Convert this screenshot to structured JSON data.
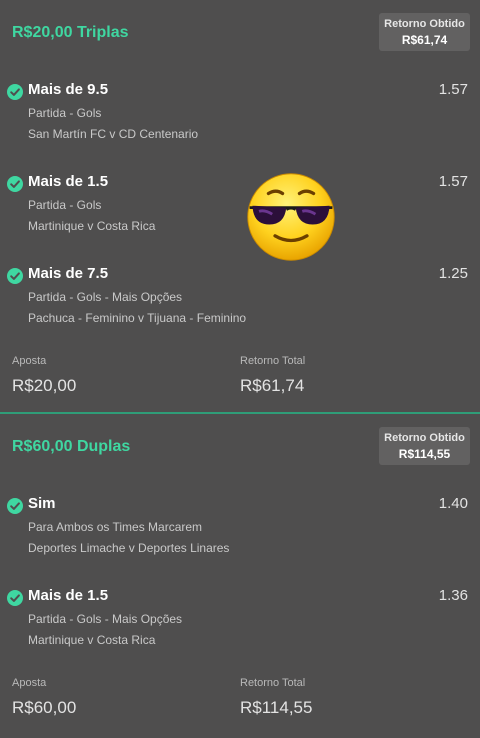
{
  "bets": [
    {
      "title": "R$20,00 Triplas",
      "return_label": "Retorno Obtido",
      "return_value": "R$61,74",
      "selections": [
        {
          "name": "Mais de 9.5",
          "odds": "1.57",
          "market": "Partida - Gols",
          "event": "San Martín FC v CD Centenario"
        },
        {
          "name": "Mais de 1.5",
          "odds": "1.57",
          "market": "Partida - Gols",
          "event": "Martinique v Costa Rica"
        },
        {
          "name": "Mais de 7.5",
          "odds": "1.25",
          "market": "Partida - Gols - Mais Opções",
          "event": "Pachuca - Feminino v Tijuana - Feminino"
        }
      ],
      "stake_label": "Aposta",
      "stake_value": "R$20,00",
      "total_label": "Retorno Total",
      "total_value": "R$61,74"
    },
    {
      "title": "R$60,00 Duplas",
      "return_label": "Retorno Obtido",
      "return_value": "R$114,55",
      "selections": [
        {
          "name": "Sim",
          "odds": "1.40",
          "market": "Para Ambos os Times Marcarem",
          "event": "Deportes Limache v Deportes Linares"
        },
        {
          "name": "Mais de 1.5",
          "odds": "1.36",
          "market": "Partida - Gols - Mais Opções",
          "event": "Martinique v Costa Rica"
        }
      ],
      "stake_label": "Aposta",
      "stake_value": "R$60,00",
      "total_label": "Retorno Total",
      "total_value": "R$114,55"
    }
  ],
  "colors": {
    "accent": "#3fd7a1",
    "panel": "#4f4e4e",
    "badge": "#626161"
  },
  "icons": {
    "check": "check-circle-icon",
    "sticker": "sunglasses-emoji"
  }
}
